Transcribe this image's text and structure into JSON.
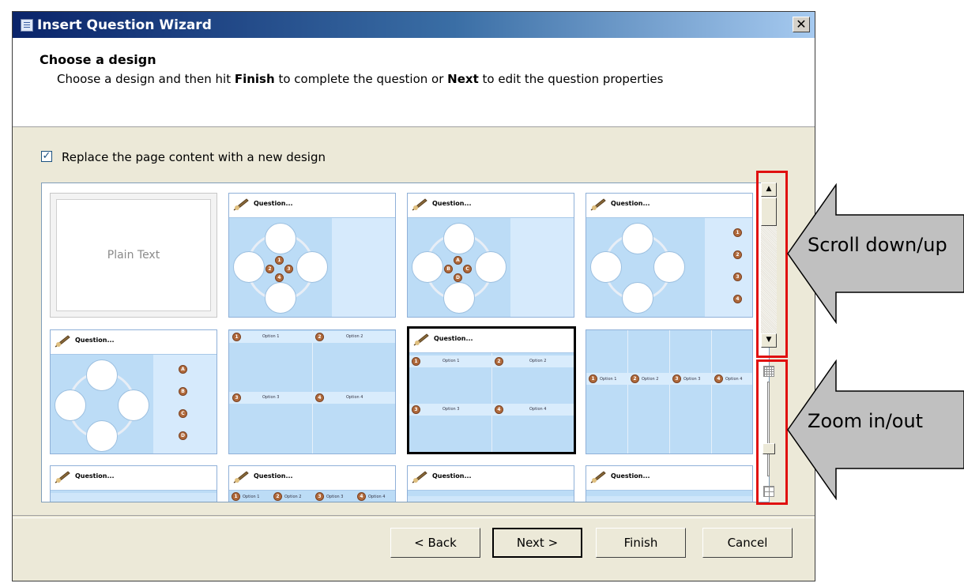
{
  "window": {
    "title": "Insert Question Wizard",
    "close_label": "✕"
  },
  "header": {
    "title": "Choose a design",
    "desc_prefix": "Choose a design and then hit ",
    "desc_finish": "Finish",
    "desc_middle": " to complete the question or ",
    "desc_next": "Next",
    "desc_suffix": " to edit the question properties"
  },
  "replace_checkbox": {
    "label": "Replace the page content with a new design",
    "checked": true
  },
  "gallery": {
    "plain_text_label": "Plain Text",
    "question_label": "Question...",
    "options": [
      "Option 1",
      "Option 2",
      "Option 3",
      "Option 4"
    ],
    "numbered_badges": [
      "1",
      "2",
      "3",
      "4"
    ],
    "lettered_badges": [
      "A",
      "B",
      "C",
      "D"
    ],
    "selected_design_index": 6
  },
  "buttons": {
    "back": "< Back",
    "next": "Next >",
    "finish": "Finish",
    "cancel": "Cancel"
  },
  "callouts": {
    "scroll": "Scroll down/up",
    "zoom": "Zoom in/out"
  },
  "colors": {
    "highlight": "#e01010",
    "callout_fill": "#c0c0c0",
    "tile_blue": "#bcdcf6"
  }
}
